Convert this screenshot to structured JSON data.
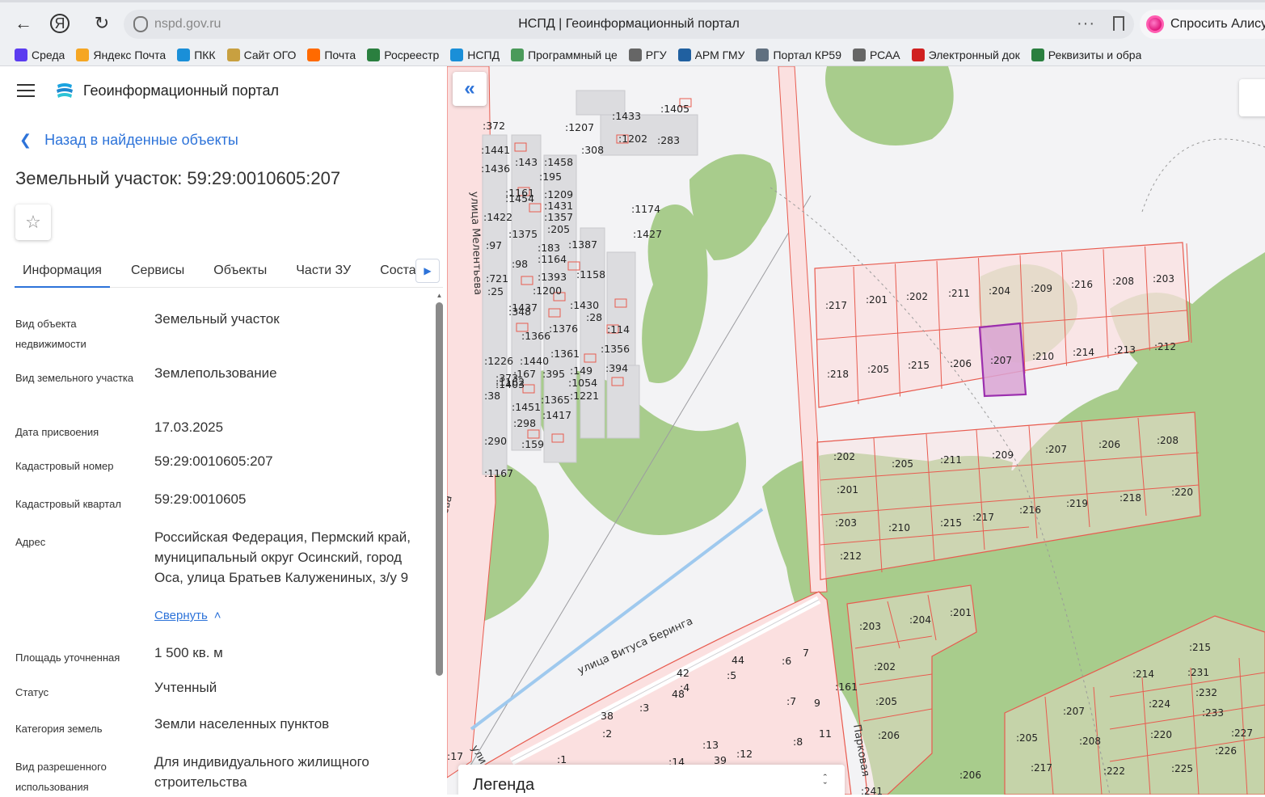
{
  "browser": {
    "url": "nspd.gov.ru",
    "tab_title": "НСПД | Геоинформационный портал",
    "alice_label": "Спросить Алису",
    "bookmarks": [
      {
        "label": "Среда",
        "color": "#5b3cf0",
        "icon": "sreda-icon"
      },
      {
        "label": "Яндекс Почта",
        "color": "#f5a623",
        "icon": "mail-icon"
      },
      {
        "label": "ПКК",
        "color": "#1a8fd8",
        "icon": "pkk-icon"
      },
      {
        "label": "Сайт ОГО",
        "color": "#c8a040",
        "icon": "ogo-icon"
      },
      {
        "label": "Почта",
        "color": "#ff6a00",
        "icon": "pochta-icon"
      },
      {
        "label": "Росреестр",
        "color": "#2a7f3f",
        "icon": "rosreestr-icon"
      },
      {
        "label": "НСПД",
        "color": "#1a8fd8",
        "icon": "nspd-icon"
      },
      {
        "label": "Программный це",
        "color": "#4a9a5a",
        "icon": "program-icon"
      },
      {
        "label": "РГУ",
        "color": "#666666",
        "icon": "document-icon"
      },
      {
        "label": "АРМ ГМУ",
        "color": "#2060a0",
        "icon": "arm-icon"
      },
      {
        "label": "Портал КР59",
        "color": "#607080",
        "icon": "portal-icon"
      },
      {
        "label": "РСАА",
        "color": "#666666",
        "icon": "document-icon"
      },
      {
        "label": "Электронный док",
        "color": "#d02020",
        "icon": "edoc-icon"
      },
      {
        "label": "Реквизиты и обра",
        "color": "#2a7f3f",
        "icon": "requisites-icon"
      }
    ]
  },
  "portal": {
    "name": "Геоинформационный портал",
    "back_label": "Назад в найденные объекты",
    "object_title": "Земельный участок: 59:29:0010605:207",
    "tabs": [
      "Информация",
      "Сервисы",
      "Объекты",
      "Части ЗУ",
      "Состав"
    ],
    "active_tab": "Информация",
    "properties": [
      {
        "label": "Вид объекта недвижимости",
        "value": "Земельный участок"
      },
      {
        "label": "Вид земельного участка",
        "value": "Землепользование"
      },
      {
        "label": "Дата присвоения",
        "value": "17.03.2025"
      },
      {
        "label": "Кадастровый номер",
        "value": "59:29:0010605:207"
      },
      {
        "label": "Кадастровый квартал",
        "value": "59:29:0010605"
      },
      {
        "label": "Адрес",
        "value": "Российская Федерация, Пермский край, муниципальный округ Осинский, город Оса, улица Братьев Калужениных, з/у 9"
      },
      {
        "label": "Площадь уточненная",
        "value": "1 500 кв. м"
      },
      {
        "label": "Статус",
        "value": "Учтенный"
      },
      {
        "label": "Категория земель",
        "value": "Земли населенных пунктов"
      },
      {
        "label": "Вид разрешенного использования",
        "value": "Для индивидуального жилищного строительства"
      }
    ],
    "collapse_label": "Свернуть"
  },
  "map": {
    "legend_title": "Легенда",
    "streets": [
      "улица Мелентьева",
      "улица Витуса Беринга",
      "Парковая",
      "ева",
      "ули"
    ],
    "parcels_row1": [
      ":217",
      ":201",
      ":202",
      ":211",
      ":204",
      ":209",
      ":216",
      ":208",
      ":203"
    ],
    "parcels_row2": [
      ":218",
      ":205",
      ":215",
      ":206",
      ":207",
      ":210",
      ":214",
      ":213",
      ":212"
    ],
    "parcels_row3": [
      ":202",
      ":205",
      ":211",
      ":209",
      ":207",
      ":206",
      ":208"
    ],
    "parcels_row4": [
      ":201",
      ":217",
      ":216",
      ":219",
      ":218",
      ":220"
    ],
    "parcels_row5": [
      ":203",
      ":210",
      ":215"
    ],
    "parcels_extra": [
      ":212"
    ],
    "parcels_south": [
      ":203",
      ":204",
      ":201",
      ":202",
      ":205",
      ":206"
    ],
    "parcels_se": [
      ":215",
      ":214",
      ":231",
      ":232",
      ":224",
      ":233",
      ":207",
      ":205",
      ":208",
      ":220",
      ":227",
      ":226",
      ":217",
      ":222",
      ":225",
      ":206",
      ":241"
    ],
    "parcels_town": [
      ":6",
      ":5",
      ":4",
      ":3",
      ":2",
      ":1",
      ":161",
      ":7",
      ":8",
      ":13",
      ":12",
      ":14",
      ":17",
      "7",
      "9",
      "11",
      "44",
      "42",
      "48",
      "38",
      "39"
    ],
    "parcels_nw": [
      ":372",
      ":1207",
      ":1433",
      ":1405",
      ":1441",
      ":308",
      ":1202",
      ":283",
      ":1436",
      ":143",
      ":1458",
      ":195",
      ":1161",
      ":1209",
      ":1454",
      ":1431",
      ":1422",
      ":1357",
      ":1375",
      ":205",
      ":97",
      ":183",
      ":1387",
      ":1164",
      ":98",
      ":721",
      ":1393",
      ":1158",
      ":25",
      ":1200",
      ":1437",
      ":348",
      ":1430",
      ":28",
      ":1366",
      ":1376",
      ":114",
      ":1356",
      ":1226",
      ":1440",
      ":1361",
      ":167",
      ":395",
      ":149",
      ":394",
      ":1403",
      ":1054",
      ":38",
      ":1221",
      ":1451",
      ":1365",
      ":1417",
      ":298",
      ":290",
      ":159",
      ":1167",
      ":1174",
      ":1427",
      ":373",
      ":1162"
    ],
    "highlight_color": "#9b2fae"
  }
}
